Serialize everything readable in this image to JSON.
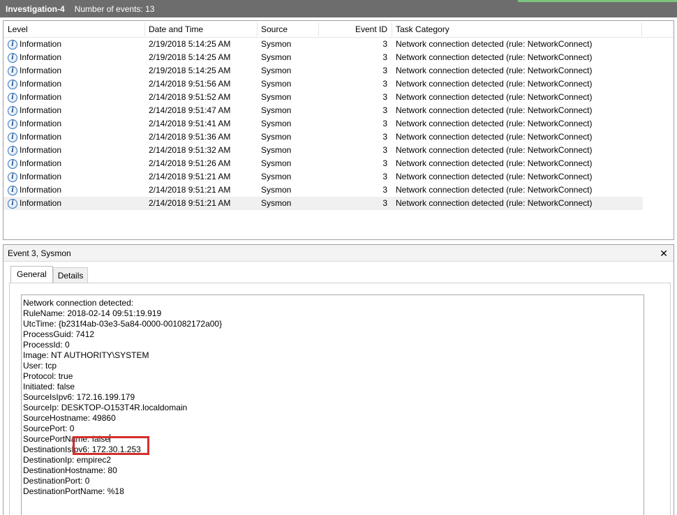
{
  "titlebar": {
    "title": "Investigation-4",
    "count_text": "Number of events: 13"
  },
  "grid": {
    "columns": [
      "Level",
      "Date and Time",
      "Source",
      "Event ID",
      "Task Category"
    ],
    "rows": [
      {
        "level": "Information",
        "date": "2/19/2018 5:14:25 AM",
        "source": "Sysmon",
        "event_id": "3",
        "task": "Network connection detected (rule: NetworkConnect)"
      },
      {
        "level": "Information",
        "date": "2/19/2018 5:14:25 AM",
        "source": "Sysmon",
        "event_id": "3",
        "task": "Network connection detected (rule: NetworkConnect)"
      },
      {
        "level": "Information",
        "date": "2/19/2018 5:14:25 AM",
        "source": "Sysmon",
        "event_id": "3",
        "task": "Network connection detected (rule: NetworkConnect)"
      },
      {
        "level": "Information",
        "date": "2/14/2018 9:51:56 AM",
        "source": "Sysmon",
        "event_id": "3",
        "task": "Network connection detected (rule: NetworkConnect)"
      },
      {
        "level": "Information",
        "date": "2/14/2018 9:51:52 AM",
        "source": "Sysmon",
        "event_id": "3",
        "task": "Network connection detected (rule: NetworkConnect)"
      },
      {
        "level": "Information",
        "date": "2/14/2018 9:51:47 AM",
        "source": "Sysmon",
        "event_id": "3",
        "task": "Network connection detected (rule: NetworkConnect)"
      },
      {
        "level": "Information",
        "date": "2/14/2018 9:51:41 AM",
        "source": "Sysmon",
        "event_id": "3",
        "task": "Network connection detected (rule: NetworkConnect)"
      },
      {
        "level": "Information",
        "date": "2/14/2018 9:51:36 AM",
        "source": "Sysmon",
        "event_id": "3",
        "task": "Network connection detected (rule: NetworkConnect)"
      },
      {
        "level": "Information",
        "date": "2/14/2018 9:51:32 AM",
        "source": "Sysmon",
        "event_id": "3",
        "task": "Network connection detected (rule: NetworkConnect)"
      },
      {
        "level": "Information",
        "date": "2/14/2018 9:51:26 AM",
        "source": "Sysmon",
        "event_id": "3",
        "task": "Network connection detected (rule: NetworkConnect)"
      },
      {
        "level": "Information",
        "date": "2/14/2018 9:51:21 AM",
        "source": "Sysmon",
        "event_id": "3",
        "task": "Network connection detected (rule: NetworkConnect)"
      },
      {
        "level": "Information",
        "date": "2/14/2018 9:51:21 AM",
        "source": "Sysmon",
        "event_id": "3",
        "task": "Network connection detected (rule: NetworkConnect)"
      },
      {
        "level": "Information",
        "date": "2/14/2018 9:51:21 AM",
        "source": "Sysmon",
        "event_id": "3",
        "task": "Network connection detected (rule: NetworkConnect)",
        "selected": true
      }
    ],
    "level_icon": "info-icon"
  },
  "detail": {
    "header": "Event 3, Sysmon",
    "close_glyph": "✕",
    "tabs": [
      "General",
      "Details"
    ],
    "active_tab": "General",
    "lines": [
      "Network connection detected:",
      "RuleName: 2018-02-14 09:51:19.919",
      "UtcTime: {b231f4ab-03e3-5a84-0000-001082172a00}",
      "ProcessGuid: 7412",
      "ProcessId: 0",
      "Image: NT AUTHORITY\\SYSTEM",
      "User: tcp",
      "Protocol: true",
      "Initiated: false",
      "SourceIsIpv6: 172.16.199.179",
      "SourceIp: DESKTOP-O153T4R.localdomain",
      "SourceHostname: 49860",
      "SourcePort: 0",
      "SourcePortName: false",
      "DestinationIsIpv6: 172.30.1.253",
      "DestinationIp: empirec2",
      "DestinationHostname: 80",
      "DestinationPort: 0",
      "DestinationPortName: %18"
    ]
  },
  "colors": {
    "titlebar_bg": "#6d6d6d",
    "highlight_box": "#d42e2e",
    "info_icon": "#3a74b8"
  }
}
